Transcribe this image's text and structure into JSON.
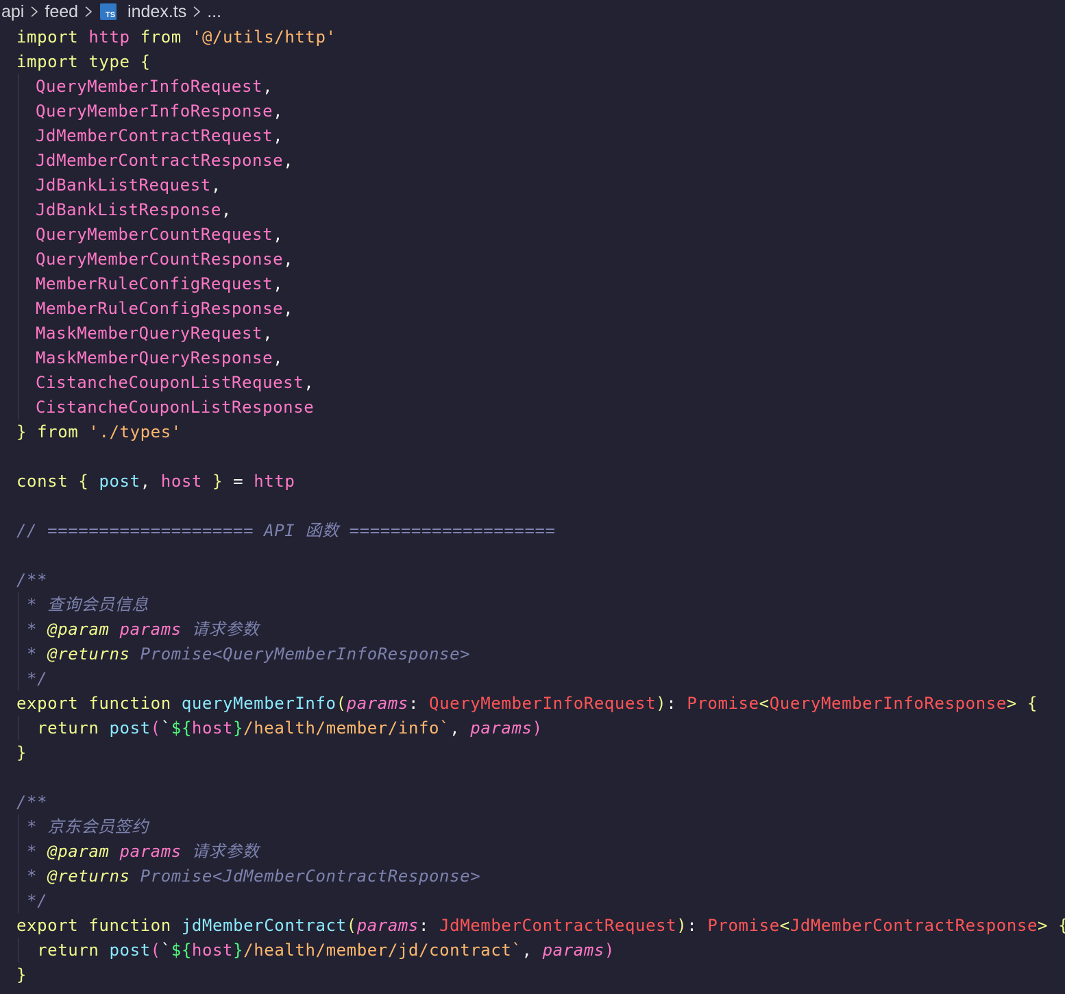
{
  "breadcrumb": {
    "items": [
      "api",
      "feed",
      "index.ts",
      "..."
    ],
    "file_icon": "TS"
  },
  "colors": {
    "background": "#222233",
    "keyword": "#F1FA8C",
    "identifier": "#FF79C6",
    "string": "#FFB86C",
    "function": "#8BE9FD",
    "type": "#FF5555",
    "comment": "#7D82AD",
    "template_punct": "#50FA7B"
  },
  "code": {
    "import_kw": "import",
    "from_kw": "from",
    "type_kw": "type",
    "http": "http",
    "http_path": "'@/utils/http'",
    "types_path": "'./types'",
    "type_names": [
      "QueryMemberInfoRequest",
      "QueryMemberInfoResponse",
      "JdMemberContractRequest",
      "JdMemberContractResponse",
      "JdBankListRequest",
      "JdBankListResponse",
      "QueryMemberCountRequest",
      "QueryMemberCountResponse",
      "MemberRuleConfigRequest",
      "MemberRuleConfigResponse",
      "MaskMemberQueryRequest",
      "MaskMemberQueryResponse",
      "CistancheCouponListRequest",
      "CistancheCouponListResponse"
    ],
    "const_kw": "const",
    "post": "post",
    "host": "host",
    "section_comment": "// ==================== API 函数 ====================",
    "doc_open": "/**",
    "doc_close": "*/",
    "export_kw": "export",
    "function_kw": "function",
    "return_kw": "return",
    "param_tag": "@param",
    "returns_tag": "@returns",
    "params": "params",
    "param_desc": "请求参数",
    "promise": "Promise",
    "functions": [
      {
        "desc": "查询会员信息",
        "name": "queryMemberInfo",
        "request_type": "QueryMemberInfoRequest",
        "response_type": "QueryMemberInfoResponse",
        "returns_doc": "Promise<QueryMemberInfoResponse>",
        "path": "/health/member/info`"
      },
      {
        "desc": "京东会员签约",
        "name": "jdMemberContract",
        "request_type": "JdMemberContractRequest",
        "response_type": "JdMemberContractResponse",
        "returns_doc": "Promise<JdMemberContractResponse>",
        "path": "/health/member/jd/contract`"
      }
    ]
  }
}
